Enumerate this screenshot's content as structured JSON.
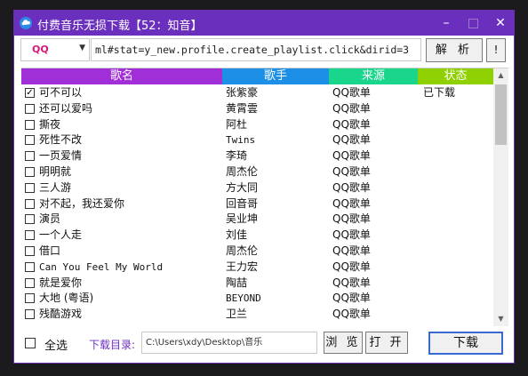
{
  "window": {
    "title": "付费音乐无损下载【52：知音】",
    "accent": "#6b2fbd",
    "min_icon": "minimize-icon",
    "max_icon": "maximize-icon",
    "close_icon": "close-icon"
  },
  "toolbar": {
    "source_selected": "QQ",
    "url_value": "ml#stat=y_new.profile.create_playlist.click&dirid=3",
    "parse_label": "解 析",
    "info_label": "!"
  },
  "table": {
    "headers": [
      {
        "label": "歌名",
        "color": "#a12fd8"
      },
      {
        "label": "歌手",
        "color": "#1d8fe6"
      },
      {
        "label": "来源",
        "color": "#19d68c"
      },
      {
        "label": "状态",
        "color": "#8fd100"
      }
    ],
    "rows": [
      {
        "checked": true,
        "name": "可不可以",
        "artist": "张紫豪",
        "source": "QQ歌单",
        "status": "已下载"
      },
      {
        "checked": false,
        "name": "还可以爱吗",
        "artist": "黄霄雲",
        "source": "QQ歌单",
        "status": ""
      },
      {
        "checked": false,
        "name": "撕夜",
        "artist": "阿杜",
        "source": "QQ歌单",
        "status": ""
      },
      {
        "checked": false,
        "name": "死性不改",
        "artist": "Twins",
        "source": "QQ歌单",
        "status": ""
      },
      {
        "checked": false,
        "name": "一页爱情",
        "artist": "李琦",
        "source": "QQ歌单",
        "status": ""
      },
      {
        "checked": false,
        "name": "明明就",
        "artist": "周杰伦",
        "source": "QQ歌单",
        "status": ""
      },
      {
        "checked": false,
        "name": "三人游",
        "artist": "方大同",
        "source": "QQ歌单",
        "status": ""
      },
      {
        "checked": false,
        "name": "对不起，我还爱你",
        "artist": "回音哥",
        "source": "QQ歌单",
        "status": ""
      },
      {
        "checked": false,
        "name": "演员",
        "artist": "吴业坤",
        "source": "QQ歌单",
        "status": ""
      },
      {
        "checked": false,
        "name": "一个人走",
        "artist": "刘佳",
        "source": "QQ歌单",
        "status": ""
      },
      {
        "checked": false,
        "name": "借口",
        "artist": "周杰伦",
        "source": "QQ歌单",
        "status": ""
      },
      {
        "checked": false,
        "name": "Can You Feel My World",
        "artist": "王力宏",
        "source": "QQ歌单",
        "status": ""
      },
      {
        "checked": false,
        "name": "就是爱你",
        "artist": "陶喆",
        "source": "QQ歌单",
        "status": ""
      },
      {
        "checked": false,
        "name": "大地 (粤语)",
        "artist": "BEYOND",
        "source": "QQ歌单",
        "status": ""
      },
      {
        "checked": false,
        "name": "残酷游戏",
        "artist": "卫兰",
        "source": "QQ歌单",
        "status": ""
      }
    ]
  },
  "footer": {
    "select_all_label": "全选",
    "dir_label": "下载目录:",
    "dir_value": "C:\\Users\\xdy\\Desktop\\音乐",
    "browse_label": "浏 览",
    "open_label": "打 开",
    "download_label": "下载"
  }
}
